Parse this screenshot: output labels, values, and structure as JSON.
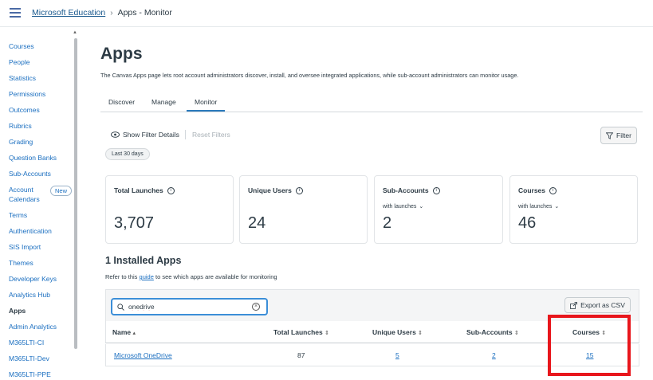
{
  "breadcrumb": {
    "root": "Microsoft Education",
    "sep": "›",
    "current": "Apps - Monitor"
  },
  "sidebar": {
    "items": [
      "Courses",
      "People",
      "Statistics",
      "Permissions",
      "Outcomes",
      "Rubrics",
      "Grading",
      "Question Banks",
      "Sub-Accounts",
      "Account",
      "Calendars",
      "Terms",
      "Authentication",
      "SIS Import",
      "Themes",
      "Developer Keys",
      "Analytics Hub",
      "Apps",
      "Admin Analytics",
      "M365LTI-CI",
      "M365LTI-Dev",
      "M365LTI-PPE"
    ],
    "new_badge": "New"
  },
  "page": {
    "title": "Apps",
    "description": "The Canvas Apps page lets root account administrators discover, install, and oversee integrated applications, while sub-account administrators can monitor usage."
  },
  "tabs": [
    "Discover",
    "Manage",
    "Monitor"
  ],
  "filters": {
    "show_details": "Show Filter Details",
    "reset": "Reset Filters",
    "chip": "Last 30 days",
    "filter_button": "Filter"
  },
  "cards": {
    "total_launches": {
      "label": "Total Launches",
      "value": "3,707"
    },
    "unique_users": {
      "label": "Unique Users",
      "value": "24"
    },
    "sub_accounts": {
      "label": "Sub-Accounts",
      "sub": "with launches",
      "value": "2"
    },
    "courses": {
      "label": "Courses",
      "sub": "with launches",
      "value": "46"
    }
  },
  "installed": {
    "title": "1 Installed Apps",
    "refer_pre": "Refer to this",
    "refer_link": "guide",
    "refer_post": "to see which apps are available for monitoring",
    "search_value": "onedrive",
    "export": "Export as CSV"
  },
  "table": {
    "headers": [
      "Name",
      "Total Launches",
      "Unique Users",
      "Sub-Accounts",
      "Courses"
    ],
    "rows": [
      {
        "name": "Microsoft OneDrive",
        "total_launches": "87",
        "unique_users": "5",
        "sub_accounts": "2",
        "courses": "15"
      }
    ]
  },
  "colors": {
    "accent": "#2b7abc",
    "link": "#1b6fc0",
    "highlight": "#e8161c"
  },
  "icons": [
    "menu-icon",
    "eye-icon",
    "filter-icon",
    "info-icon",
    "chevron-down-icon",
    "search-icon",
    "clear-icon",
    "export-icon",
    "sort-icon"
  ]
}
